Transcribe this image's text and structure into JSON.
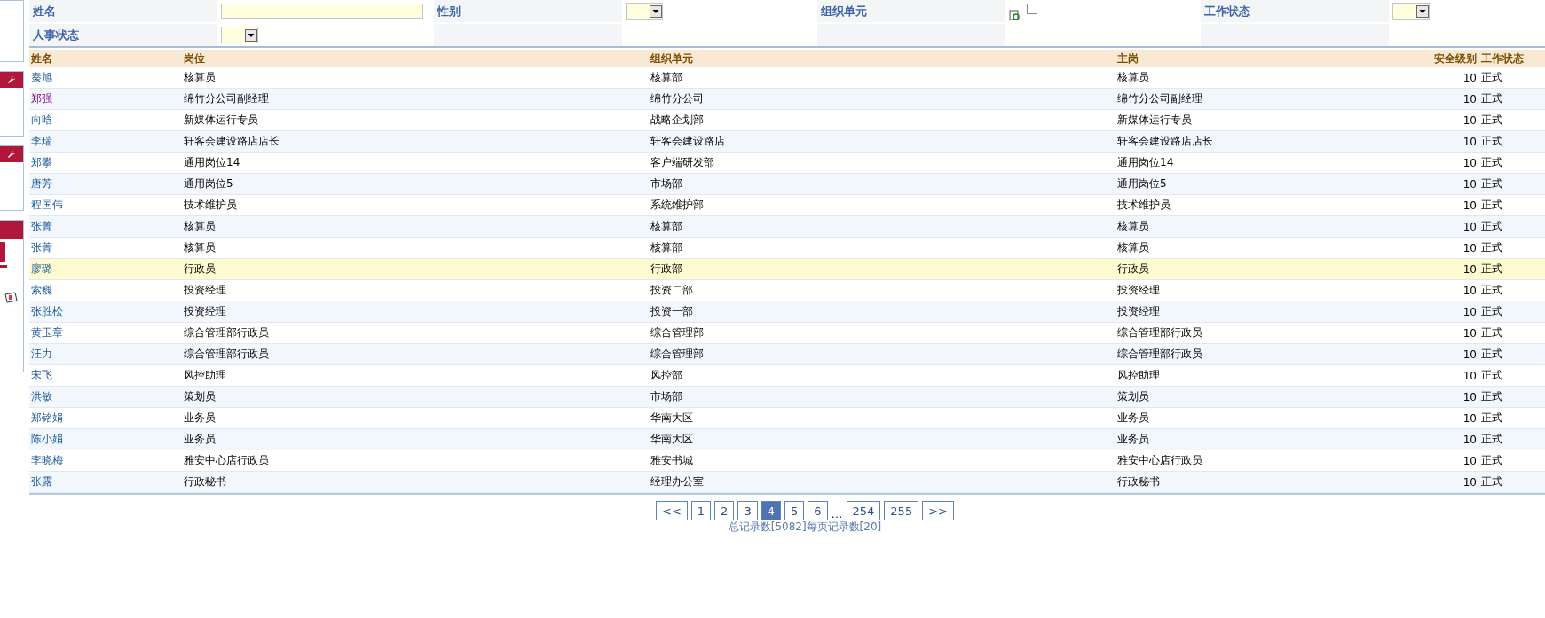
{
  "filters": [
    {
      "label": "姓名",
      "kind": "text"
    },
    {
      "label": "性别",
      "kind": "select"
    },
    {
      "label": "组织单元",
      "kind": "lookup",
      "checked": false
    },
    {
      "label": "工作状态",
      "kind": "select"
    },
    {
      "label": "人事状态",
      "kind": "select"
    }
  ],
  "table": {
    "columns": [
      "姓名",
      "岗位",
      "组织单元",
      "主岗",
      "安全级别",
      "工作状态"
    ],
    "rows": [
      {
        "cells": [
          "秦旭",
          "核算员",
          "核算部",
          "核算员",
          "10",
          "正式"
        ],
        "visited": false,
        "selected": false
      },
      {
        "cells": [
          "郑强",
          "绵竹分公司副经理",
          "绵竹分公司",
          "绵竹分公司副经理",
          "10",
          "正式"
        ],
        "visited": true,
        "selected": false
      },
      {
        "cells": [
          "向晗",
          "新媒体运行专员",
          "战略企划部",
          "新媒体运行专员",
          "10",
          "正式"
        ],
        "visited": false,
        "selected": false
      },
      {
        "cells": [
          "李瑞",
          "轩客会建设路店店长",
          "轩客会建设路店",
          "轩客会建设路店店长",
          "10",
          "正式"
        ],
        "visited": false,
        "selected": false
      },
      {
        "cells": [
          "郑攀",
          "通用岗位14",
          "客户端研发部",
          "通用岗位14",
          "10",
          "正式"
        ],
        "visited": false,
        "selected": false
      },
      {
        "cells": [
          "唐芳",
          "通用岗位5",
          "市场部",
          "通用岗位5",
          "10",
          "正式"
        ],
        "visited": false,
        "selected": false
      },
      {
        "cells": [
          "程国伟",
          "技术维护员",
          "系统维护部",
          "技术维护员",
          "10",
          "正式"
        ],
        "visited": false,
        "selected": false
      },
      {
        "cells": [
          "张菁",
          "核算员",
          "核算部",
          "核算员",
          "10",
          "正式"
        ],
        "visited": false,
        "selected": false
      },
      {
        "cells": [
          "张菁",
          "核算员",
          "核算部",
          "核算员",
          "10",
          "正式"
        ],
        "visited": false,
        "selected": false
      },
      {
        "cells": [
          "廖璐",
          "行政员",
          "行政部",
          "行政员",
          "10",
          "正式"
        ],
        "visited": false,
        "selected": true
      },
      {
        "cells": [
          "索巍",
          "投资经理",
          "投资二部",
          "投资经理",
          "10",
          "正式"
        ],
        "visited": false,
        "selected": false
      },
      {
        "cells": [
          "张胜松",
          "投资经理",
          "投资一部",
          "投资经理",
          "10",
          "正式"
        ],
        "visited": false,
        "selected": false
      },
      {
        "cells": [
          "黄玉章",
          "综合管理部行政员",
          "综合管理部",
          "综合管理部行政员",
          "10",
          "正式"
        ],
        "visited": false,
        "selected": false
      },
      {
        "cells": [
          "汪力",
          "综合管理部行政员",
          "综合管理部",
          "综合管理部行政员",
          "10",
          "正式"
        ],
        "visited": false,
        "selected": false
      },
      {
        "cells": [
          "宋飞",
          "风控助理",
          "风控部",
          "风控助理",
          "10",
          "正式"
        ],
        "visited": false,
        "selected": false
      },
      {
        "cells": [
          "洪敏",
          "策划员",
          "市场部",
          "策划员",
          "10",
          "正式"
        ],
        "visited": false,
        "selected": false
      },
      {
        "cells": [
          "郑铭娟",
          "业务员",
          "华南大区",
          "业务员",
          "10",
          "正式"
        ],
        "visited": false,
        "selected": false
      },
      {
        "cells": [
          "陈小娟",
          "业务员",
          "华南大区",
          "业务员",
          "10",
          "正式"
        ],
        "visited": false,
        "selected": false
      },
      {
        "cells": [
          "李晓梅",
          "雅安中心店行政员",
          "雅安书城",
          "雅安中心店行政员",
          "10",
          "正式"
        ],
        "visited": false,
        "selected": false
      },
      {
        "cells": [
          "张露",
          "行政秘书",
          "经理办公室",
          "行政秘书",
          "10",
          "正式"
        ],
        "visited": false,
        "selected": false
      }
    ]
  },
  "pagination": {
    "items": [
      {
        "kind": "page",
        "label": "<<",
        "selected": false
      },
      {
        "kind": "page",
        "label": "1",
        "selected": false
      },
      {
        "kind": "page",
        "label": "2",
        "selected": false
      },
      {
        "kind": "page",
        "label": "3",
        "selected": false
      },
      {
        "kind": "page",
        "label": "4",
        "selected": true
      },
      {
        "kind": "page",
        "label": "5",
        "selected": false
      },
      {
        "kind": "page",
        "label": "6",
        "selected": false
      },
      {
        "kind": "gap",
        "label": "…"
      },
      {
        "kind": "page",
        "label": "254",
        "selected": false
      },
      {
        "kind": "page",
        "label": "255",
        "selected": false
      },
      {
        "kind": "page",
        "label": ">>",
        "selected": false
      }
    ],
    "summary": "总记录数[5082]每页记录数[20]"
  }
}
